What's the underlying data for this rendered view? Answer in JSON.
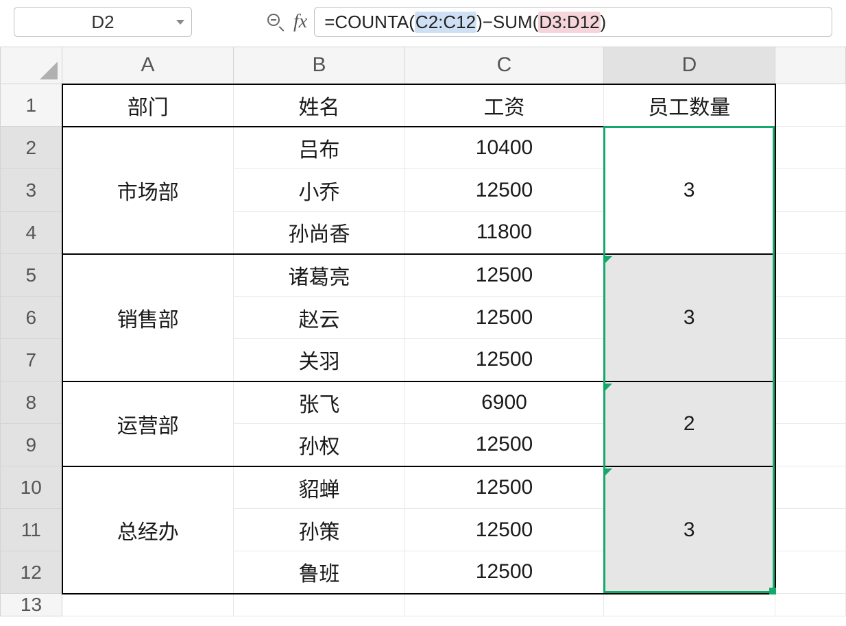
{
  "nameBox": "D2",
  "formula": {
    "text1": "=COUNTA(",
    "ref1": "C2:C12",
    "text2": ")−SUM(",
    "ref2": "D3:D12",
    "text3": ")"
  },
  "columns": [
    "A",
    "B",
    "C",
    "D"
  ],
  "rowNumbers": [
    "1",
    "2",
    "3",
    "4",
    "5",
    "6",
    "7",
    "8",
    "9",
    "10",
    "11",
    "12",
    "13"
  ],
  "headers": {
    "A": "部门",
    "B": "姓名",
    "C": "工资",
    "D": "员工数量"
  },
  "data": {
    "groups": [
      {
        "dept": "市场部",
        "count": "3",
        "rows": [
          {
            "name": "吕布",
            "salary": "10400"
          },
          {
            "name": "小乔",
            "salary": "12500"
          },
          {
            "name": "孙尚香",
            "salary": "11800"
          }
        ]
      },
      {
        "dept": "销售部",
        "count": "3",
        "rows": [
          {
            "name": "诸葛亮",
            "salary": "12500"
          },
          {
            "name": "赵云",
            "salary": "12500"
          },
          {
            "name": "关羽",
            "salary": "12500"
          }
        ]
      },
      {
        "dept": "运营部",
        "count": "2",
        "rows": [
          {
            "name": "张飞",
            "salary": "6900"
          },
          {
            "name": "孙权",
            "salary": "12500"
          }
        ]
      },
      {
        "dept": "总经办",
        "count": "3",
        "rows": [
          {
            "name": "貂蝉",
            "salary": "12500"
          },
          {
            "name": "孙策",
            "salary": "12500"
          },
          {
            "name": "鲁班",
            "salary": "12500"
          }
        ]
      }
    ]
  },
  "chart_data": {
    "type": "table",
    "columns": [
      "部门",
      "姓名",
      "工资",
      "员工数量"
    ],
    "rows": [
      [
        "市场部",
        "吕布",
        10400,
        3
      ],
      [
        "市场部",
        "小乔",
        12500,
        3
      ],
      [
        "市场部",
        "孙尚香",
        11800,
        3
      ],
      [
        "销售部",
        "诸葛亮",
        12500,
        3
      ],
      [
        "销售部",
        "赵云",
        12500,
        3
      ],
      [
        "销售部",
        "关羽",
        12500,
        3
      ],
      [
        "运营部",
        "张飞",
        6900,
        2
      ],
      [
        "运营部",
        "孙权",
        12500,
        2
      ],
      [
        "总经办",
        "貂蝉",
        12500,
        3
      ],
      [
        "总经办",
        "孙策",
        12500,
        3
      ],
      [
        "总经办",
        "鲁班",
        12500,
        3
      ]
    ]
  }
}
